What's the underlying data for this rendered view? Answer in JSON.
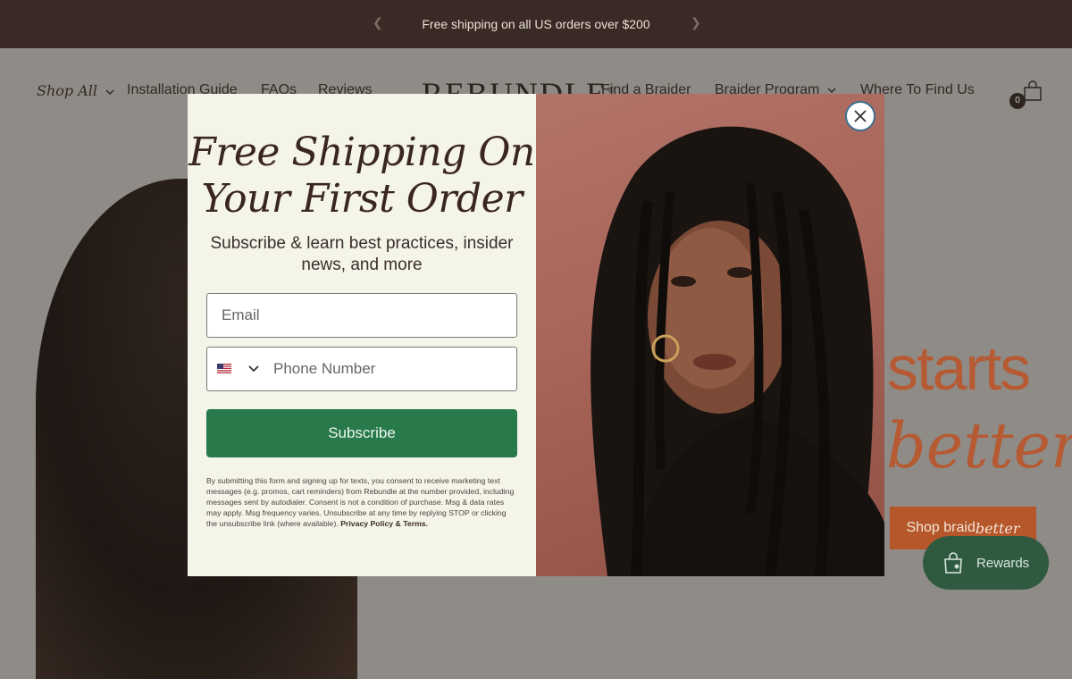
{
  "announcement": {
    "text": "Free shipping on all US orders over $200",
    "prev_icon": "chevron-left-icon",
    "next_icon": "chevron-right-icon"
  },
  "header": {
    "nav_left": [
      {
        "label": "Shop All"
      },
      {
        "label": "Installation Guide"
      },
      {
        "label": "FAQs"
      },
      {
        "label": "Reviews"
      }
    ],
    "logo": "REBUNDLE",
    "nav_right": [
      {
        "label": "Find a Braider"
      },
      {
        "label": "Braider Program"
      },
      {
        "label": "Where To Find Us"
      }
    ],
    "cart_count": "0"
  },
  "hero": {
    "line1": "starts",
    "line2": "better",
    "cta_prefix": "Shop braid",
    "cta_suffix": "better"
  },
  "rewards": {
    "label": "Rewards",
    "icon": "shopping-bag-icon"
  },
  "modal": {
    "title": "Free Shipping On Your First Order",
    "subtitle": "Subscribe & learn best practices, insider news, and more",
    "email_placeholder": "Email",
    "phone_placeholder": "Phone Number",
    "country_flag": "us-flag-icon",
    "subscribe_label": "Subscribe",
    "legal_text": "By submitting this form and signing up for texts, you consent to receive marketing text messages (e.g. promos, cart reminders) from Rebundle at the number provided, including messages sent by autodialer. Consent is not a condition of purchase. Msg & data rates may apply. Msg frequency varies. Unsubscribe at any time by replying STOP or clicking the unsubscribe link (where available).",
    "legal_link": "Privacy Policy & Terms.",
    "close_icon": "close-icon"
  },
  "colors": {
    "announcement_bg": "#3a2a25",
    "modal_left_bg": "#f4f4e9",
    "subscribe_bg": "#287a4a",
    "hero_accent": "#b65a33",
    "rewards_bg": "#2f5a40"
  }
}
